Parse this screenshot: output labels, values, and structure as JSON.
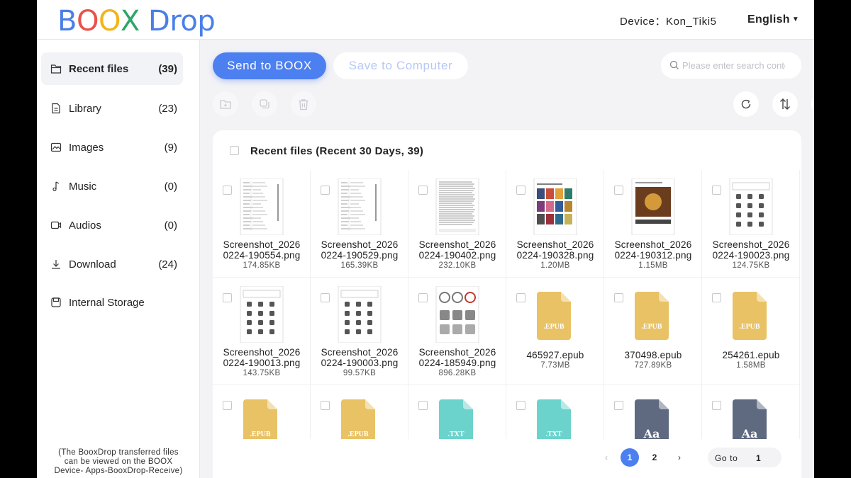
{
  "header": {
    "logo_letters": [
      {
        "ch": "B",
        "color": "#4A7FE8"
      },
      {
        "ch": "O",
        "color": "#E8524A"
      },
      {
        "ch": "O",
        "color": "#F2B41B"
      },
      {
        "ch": "X",
        "color": "#2BA866"
      },
      {
        "ch": " Drop",
        "color": "#4A7FE8"
      }
    ],
    "device": "Device：Kon_Tiki5",
    "language": "English"
  },
  "sidebar": {
    "items": [
      {
        "label": "Recent files",
        "count": "(39)",
        "icon": "folder-icon",
        "active": true
      },
      {
        "label": "Library",
        "count": "(23)",
        "icon": "document-icon",
        "active": false
      },
      {
        "label": "Images",
        "count": "(9)",
        "icon": "image-icon",
        "active": false
      },
      {
        "label": "Music",
        "count": "(0)",
        "icon": "music-note-icon",
        "active": false
      },
      {
        "label": "Audios",
        "count": "(0)",
        "icon": "video-icon",
        "active": false
      },
      {
        "label": "Download",
        "count": "(24)",
        "icon": "download-icon",
        "active": false
      },
      {
        "label": "Internal Storage",
        "count": "",
        "icon": "storage-icon",
        "active": false
      }
    ],
    "note": [
      "(The BooxDrop transferred files",
      "can be viewed on the BOOX",
      "Device- Apps-BooxDrop-Receive)"
    ]
  },
  "toolbar": {
    "send_label": "Send to BOOX",
    "save_label": "Save to Computer",
    "search_placeholder": "Please enter search content"
  },
  "panel": {
    "title": "Recent files (Recent 30 Days, 39)",
    "files": [
      {
        "name": [
          "Screenshot_2026",
          "0224-190554.png"
        ],
        "size": "174.85KB",
        "kind": "shot-menu"
      },
      {
        "name": [
          "Screenshot_2026",
          "0224-190529.png"
        ],
        "size": "165.39KB",
        "kind": "shot-menu"
      },
      {
        "name": [
          "Screenshot_2026",
          "0224-190402.png"
        ],
        "size": "232.10KB",
        "kind": "shot-text"
      },
      {
        "name": [
          "Screenshot_2026",
          "0224-190328.png"
        ],
        "size": "1.20MB",
        "kind": "shot-books"
      },
      {
        "name": [
          "Screenshot_2026",
          "0224-190312.png"
        ],
        "size": "1.15MB",
        "kind": "shot-cover"
      },
      {
        "name": [
          "Screenshot_2026",
          "0224-190023.png"
        ],
        "size": "124.75KB",
        "kind": "shot-apps"
      },
      {
        "name": [
          "Screenshot_2026",
          "0224-190013.png"
        ],
        "size": "143.75KB",
        "kind": "shot-apps"
      },
      {
        "name": [
          "Screenshot_2026",
          "0224-190003.png"
        ],
        "size": "99.57KB",
        "kind": "shot-apps"
      },
      {
        "name": [
          "Screenshot_2026",
          "0224-185949.png"
        ],
        "size": "896.28KB",
        "kind": "shot-gauges"
      },
      {
        "name": [
          "465927.epub"
        ],
        "size": "7.73MB",
        "kind": "epub"
      },
      {
        "name": [
          "370498.epub"
        ],
        "size": "727.89KB",
        "kind": "epub"
      },
      {
        "name": [
          "254261.epub"
        ],
        "size": "1.58MB",
        "kind": "epub"
      },
      {
        "name": [],
        "size": "",
        "kind": "epub"
      },
      {
        "name": [],
        "size": "",
        "kind": "epub"
      },
      {
        "name": [],
        "size": "",
        "kind": "txt"
      },
      {
        "name": [],
        "size": "",
        "kind": "txt"
      },
      {
        "name": [],
        "size": "",
        "kind": "font"
      },
      {
        "name": [],
        "size": "",
        "kind": "font"
      }
    ],
    "file_icon_labels": {
      "epub": ".EPUB",
      "txt": ".TXT",
      "font": "Aa"
    },
    "colors": {
      "epub": "#E9C265",
      "txt": "#6CD3CC",
      "font": "#5F6A80",
      "accent": "#4C7FF0"
    }
  },
  "pagination": {
    "pages": [
      "1",
      "2"
    ],
    "current_page": "1",
    "goto_label": "Go to",
    "goto_value": "1"
  }
}
